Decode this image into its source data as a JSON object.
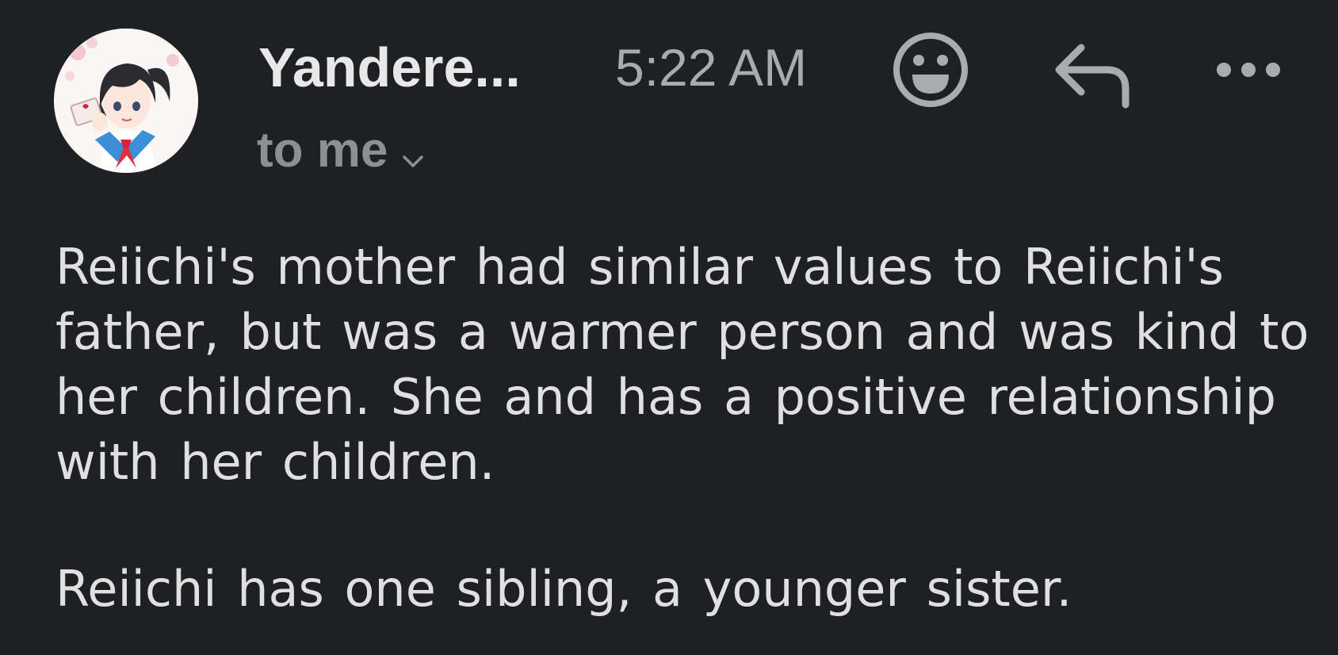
{
  "email": {
    "sender_name": "Yandere...",
    "time": "5:22 AM",
    "recipient": "to me",
    "paragraphs": [
      "Reiichi's mother had similar values to Reiichi's father, but was a warmer person and was kind to her children. She and has a positive relationship with her children.",
      "Reiichi has one sibling, a younger sister."
    ]
  },
  "icons": {
    "avatar": "avatar-anime-schoolgirl",
    "emoji": "smiley-face-icon",
    "reply": "reply-arrow-icon",
    "more": "more-horizontal-icon",
    "expand": "chevron-down-icon"
  },
  "colors": {
    "background": "#1f2024",
    "primary_text": "#e8e8e8",
    "secondary_text": "#8d8f93",
    "icon": "#a9abaf"
  }
}
